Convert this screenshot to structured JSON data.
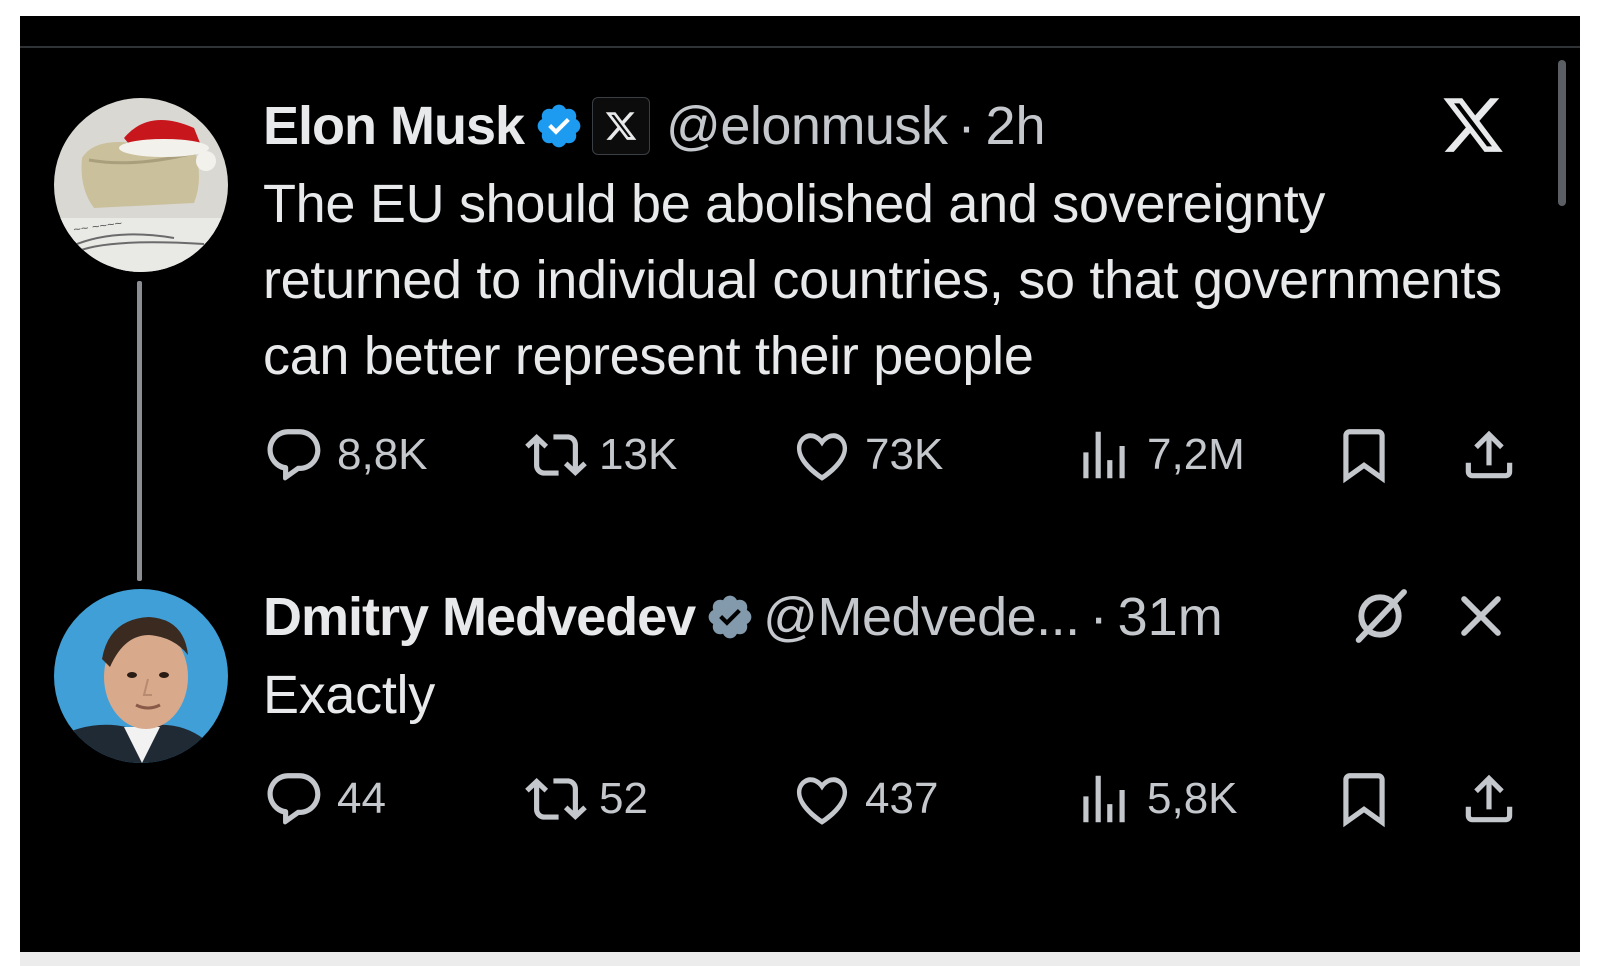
{
  "colors": {
    "background": "#000000",
    "text": "#e7e9ea",
    "muted": "#c4c8cc",
    "verified": "#1d9bf0"
  },
  "tweets": [
    {
      "name": "Elon Musk",
      "badge_icon": "x-affiliate-badge-icon",
      "handle": "@elonmusk",
      "separator": "·",
      "time": "2h",
      "text": "The EU should be abolished and sovereignty returned to individual countries, so that governments can better represent their people",
      "corner_icon": "x-logo-icon",
      "actions": {
        "replies": "8,8K",
        "retweets": "13K",
        "likes": "73K",
        "views": "7,2M"
      }
    },
    {
      "name": "Dmitry Medvedev",
      "handle": "@Medvede...",
      "separator": "·",
      "time": "31m",
      "text": "Exactly",
      "corner_icons": [
        "slash-circle-icon",
        "close-icon"
      ],
      "actions": {
        "replies": "44",
        "retweets": "52",
        "likes": "437",
        "views": "5,8K"
      }
    }
  ]
}
